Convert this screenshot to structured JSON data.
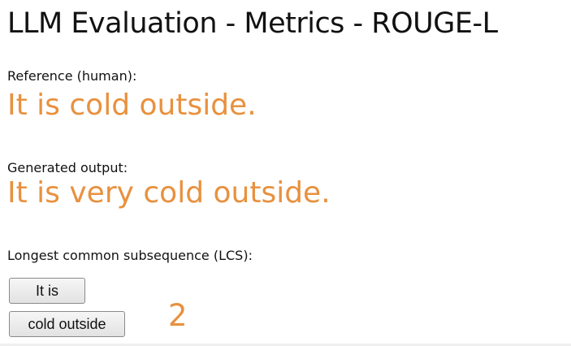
{
  "slide": {
    "title": "LLM Evaluation - Metrics - ROUGE-L"
  },
  "reference": {
    "label": "Reference (human):",
    "text": "It is cold outside."
  },
  "generated": {
    "label": "Generated output:",
    "text": "It is very cold outside."
  },
  "lcs": {
    "label": "Longest common subsequence (LCS):",
    "segments": [
      "It is",
      "cold outside"
    ],
    "count": "2"
  },
  "colors": {
    "accent": "#e8913f",
    "text": "#111111",
    "background": "#ffffff"
  }
}
